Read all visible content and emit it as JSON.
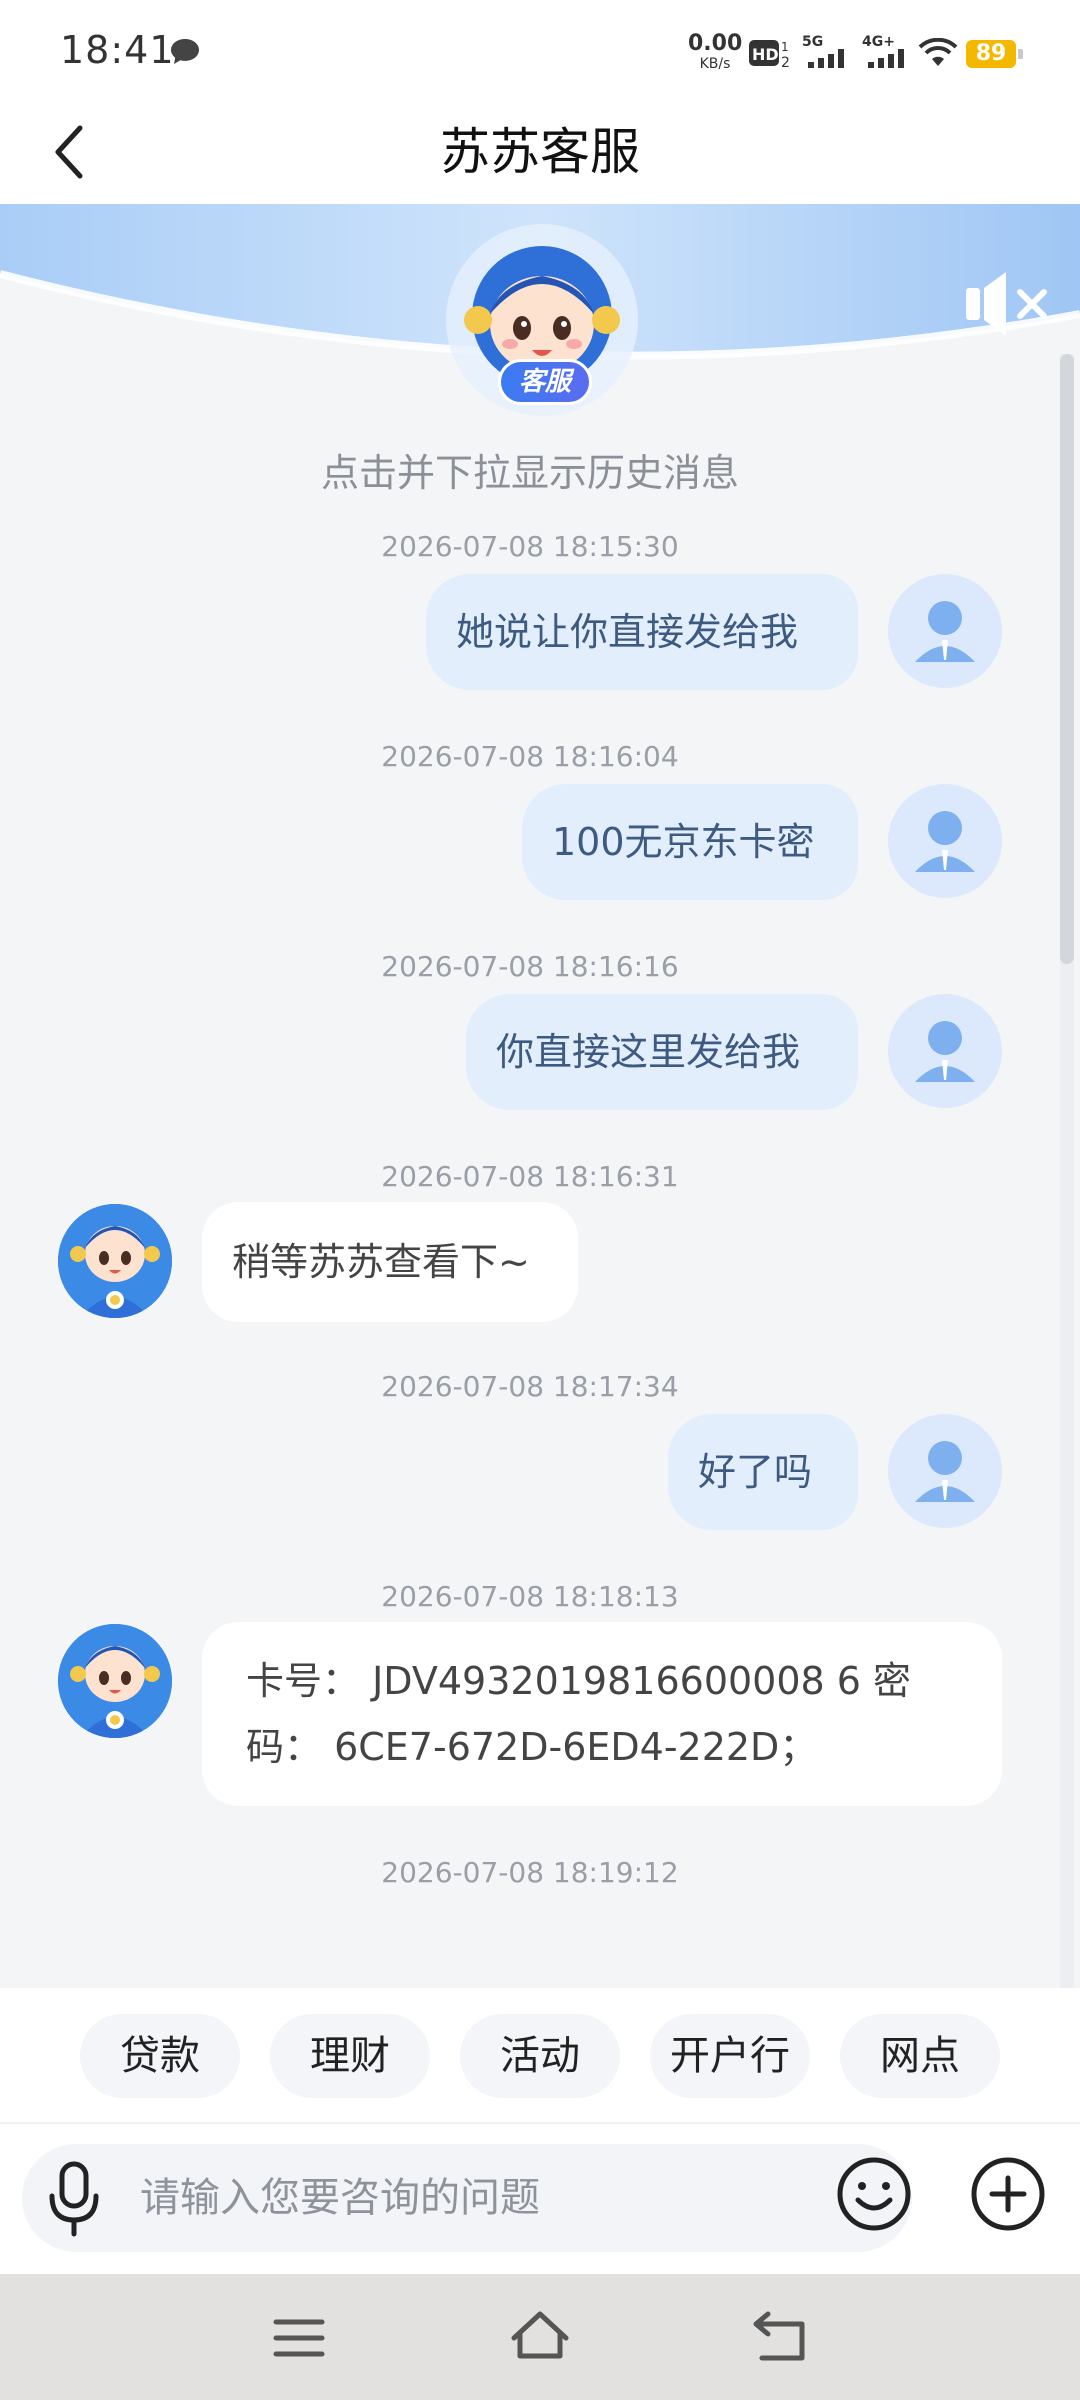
{
  "status_bar": {
    "time": "18:41",
    "net_speed_value": "0.00",
    "net_speed_unit": "KB/s",
    "battery": "89",
    "battery_color": "#f5b800"
  },
  "header": {
    "title": "苏苏客服",
    "back_icon": "chevron-left-icon"
  },
  "banner": {
    "badge": "客服",
    "mute_icon": "speaker-muted-icon"
  },
  "chat": {
    "history_hint": "点击并下拉显示历史消息",
    "messages": [
      {
        "time": "2026-07-08 18:15:30",
        "sender": "user",
        "text": "她说让你直接发给我"
      },
      {
        "time": "2026-07-08 18:16:04",
        "sender": "user",
        "text": "100无京东卡密"
      },
      {
        "time": "2026-07-08 18:16:16",
        "sender": "user",
        "text": "你直接这里发给我"
      },
      {
        "time": "2026-07-08 18:16:31",
        "sender": "agent",
        "text": "稍等苏苏查看下~"
      },
      {
        "time": "2026-07-08 18:17:34",
        "sender": "user",
        "text": "好了吗"
      },
      {
        "time": "2026-07-08 18:18:13",
        "sender": "agent",
        "text_line1": "卡号： JDV4932019816600008 6 密",
        "text_line2": "码： 6CE7-672D-6ED4-222D；"
      },
      {
        "time": "2026-07-08 18:19:12"
      }
    ]
  },
  "quick_replies": [
    "贷款",
    "理财",
    "活动",
    "开户行",
    "网点"
  ],
  "input": {
    "placeholder": "请输入您要咨询的问题",
    "value": ""
  },
  "colors": {
    "accent": "#3b7bf2",
    "user_bubble": "#e3eefd",
    "agent_bubble": "#ffffff"
  }
}
